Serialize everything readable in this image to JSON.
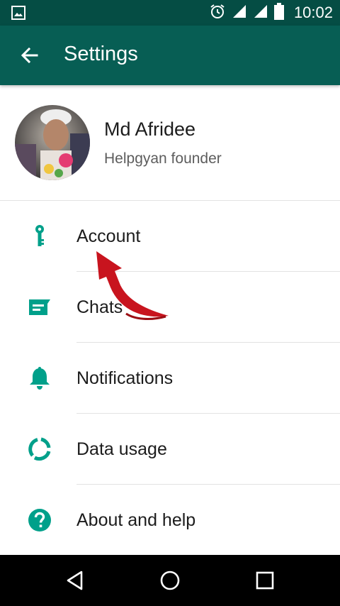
{
  "status_bar": {
    "time": "10:02",
    "icons": [
      "image-icon",
      "alarm-icon",
      "signal-icon",
      "signal-icon",
      "battery-icon"
    ]
  },
  "app_bar": {
    "title": "Settings",
    "back_icon": "arrow-back-icon"
  },
  "profile": {
    "name": "Md Afridee",
    "status": "Helpgyan founder"
  },
  "menu": {
    "items": [
      {
        "label": "Account",
        "icon": "key-icon"
      },
      {
        "label": "Chats",
        "icon": "chat-icon"
      },
      {
        "label": "Notifications",
        "icon": "bell-icon"
      },
      {
        "label": "Data usage",
        "icon": "data-usage-icon"
      },
      {
        "label": "About and help",
        "icon": "help-icon"
      }
    ]
  },
  "colors": {
    "status_bar": "#054d44",
    "app_bar": "#075e54",
    "icon_accent": "#00a08a",
    "annotation_arrow": "#c8141e"
  },
  "nav_bar": {
    "buttons": [
      "back-triangle-icon",
      "home-circle-icon",
      "recents-square-icon"
    ]
  }
}
